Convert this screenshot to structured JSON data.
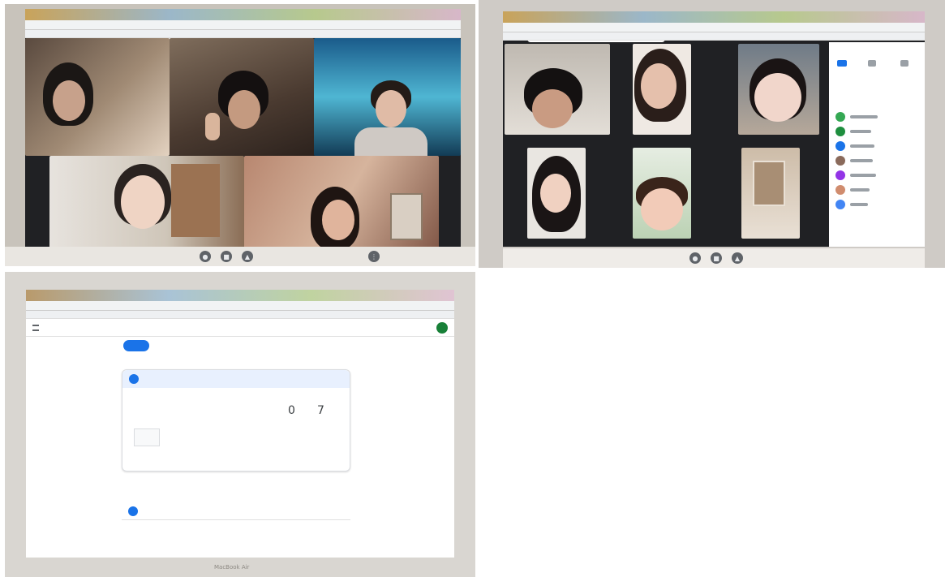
{
  "photo_a": {
    "description_tags": [
      "meet-grid-5"
    ],
    "bottom_bar": {
      "meeting_code": "",
      "icons": [
        "mic-icon",
        "video-icon",
        "present-icon",
        "more-icon",
        "end-call-icon"
      ]
    }
  },
  "photo_b": {
    "description_tags": [
      "meet-grid-8"
    ],
    "sidebar": {
      "title": "",
      "tabs": [
        "people-tab",
        "chat-tab",
        "activities-tab"
      ]
    }
  },
  "photo_c": {
    "page": {
      "header_title": "",
      "top_tabs": [
        "",
        "",
        "",
        ""
      ],
      "sidebar_items": [
        "",
        "",
        "",
        "",
        "",
        ""
      ],
      "create_button": "",
      "topic_1": {
        "title": "",
        "card_title": "",
        "stat_1": "0",
        "stat_2": "7",
        "assignment": ""
      },
      "topic_2": {
        "title": "",
        "card_title": ""
      }
    },
    "device_label": "MacBook Air"
  },
  "colors": {
    "meet_bg": "#202124",
    "accent_blue": "#1a73e8",
    "classroom_bg": "#ffffff"
  }
}
